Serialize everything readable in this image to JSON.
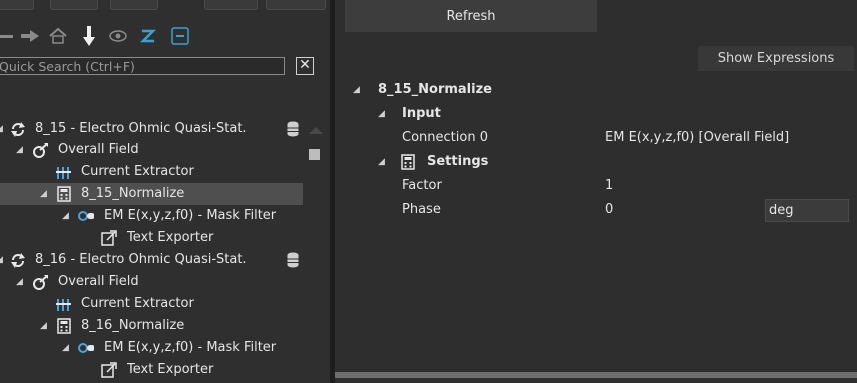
{
  "tree": {
    "search_placeholder": "Quick Search (Ctrl+F)",
    "clear_symbol": "✕",
    "items": [
      {
        "label": "8_15 - Electro Ohmic Quasi-Stat.",
        "icon": "cycle-icon"
      },
      {
        "label": "Overall Field",
        "icon": "field-icon"
      },
      {
        "label": "Current Extractor",
        "icon": "extractor-icon"
      },
      {
        "label": "8_15_Normalize",
        "icon": "calculator-icon"
      },
      {
        "label": "EM E(x,y,z,f0) - Mask Filter",
        "icon": "mask-filter-icon"
      },
      {
        "label": "Text Exporter",
        "icon": "export-icon"
      },
      {
        "label": "8_16 - Electro Ohmic Quasi-Stat.",
        "icon": "cycle-icon"
      },
      {
        "label": "Overall Field",
        "icon": "field-icon"
      },
      {
        "label": "Current Extractor",
        "icon": "extractor-icon"
      },
      {
        "label": "8_16_Normalize",
        "icon": "calculator-icon"
      },
      {
        "label": "EM E(x,y,z,f0) - Mask Filter",
        "icon": "mask-filter-icon"
      },
      {
        "label": "Text Exporter",
        "icon": "export-icon"
      }
    ]
  },
  "properties": {
    "refresh_label": "Refresh",
    "show_expressions_label": "Show Expressions",
    "root_label": "8_15_Normalize",
    "input_group": "Input",
    "connection_label": "Connection 0",
    "connection_value": "EM E(x,y,z,f0) [Overall Field]",
    "settings_group": "Settings",
    "factor_label": "Factor",
    "factor_value": "1",
    "phase_label": "Phase",
    "phase_value": "0",
    "phase_unit": "deg"
  }
}
